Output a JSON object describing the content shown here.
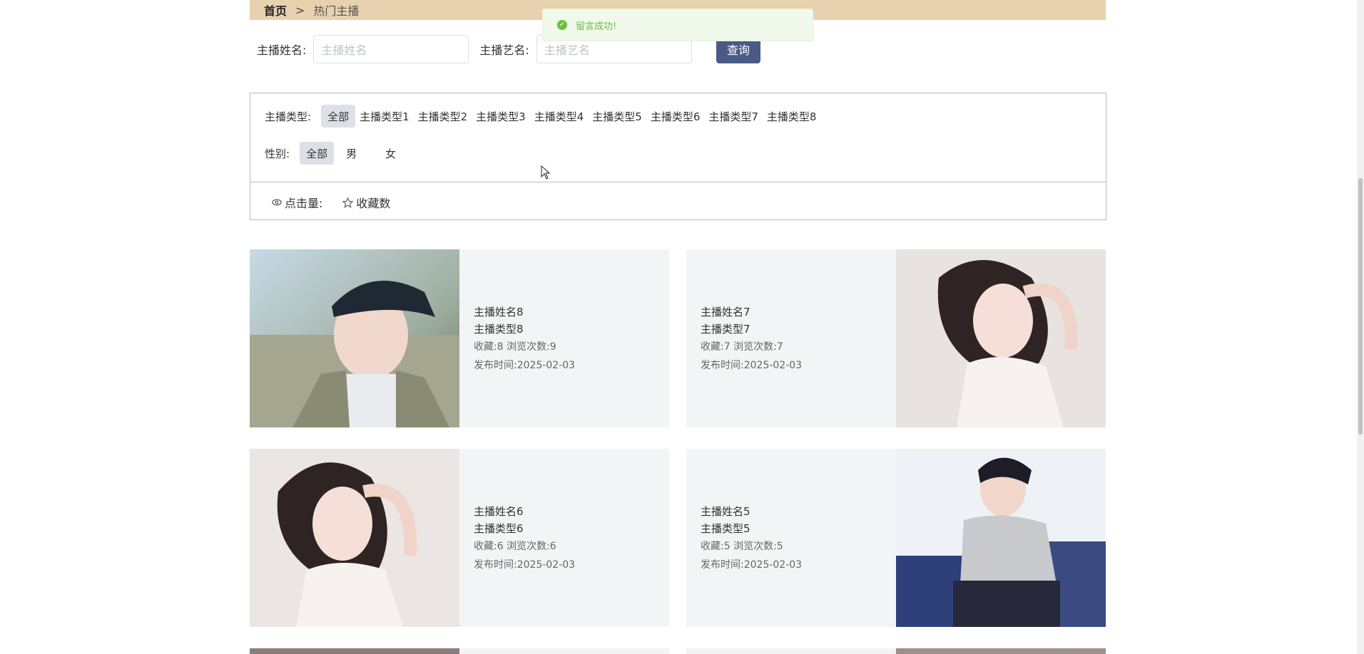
{
  "breadcrumb": {
    "home": "首页",
    "separator": ">",
    "current": "热门主播"
  },
  "toast": {
    "message": "留言成功!"
  },
  "search": {
    "name_label": "主播姓名:",
    "name_placeholder": "主播姓名",
    "stage_label": "主播艺名:",
    "stage_placeholder": "主播艺名",
    "button": "查询"
  },
  "filters": {
    "type_label": "主播类型:",
    "types": [
      "全部",
      "主播类型1",
      "主播类型2",
      "主播类型3",
      "主播类型4",
      "主播类型5",
      "主播类型6",
      "主播类型7",
      "主播类型8"
    ],
    "gender_label": "性别:",
    "genders": [
      "全部",
      "男",
      "女"
    ]
  },
  "sort": {
    "clicks": "点击量:",
    "favorites": "收藏数"
  },
  "cards": [
    {
      "name": "主播姓名8",
      "type": "主播类型8",
      "stats": "收藏:8  浏览次数:9",
      "date": "发布时间:2025-02-03"
    },
    {
      "name": "主播姓名7",
      "type": "主播类型7",
      "stats": "收藏:7  浏览次数:7",
      "date": "发布时间:2025-02-03"
    },
    {
      "name": "主播姓名6",
      "type": "主播类型6",
      "stats": "收藏:6  浏览次数:6",
      "date": "发布时间:2025-02-03"
    },
    {
      "name": "主播姓名5",
      "type": "主播类型5",
      "stats": "收藏:5  浏览次数:5",
      "date": "发布时间:2025-02-03"
    }
  ]
}
